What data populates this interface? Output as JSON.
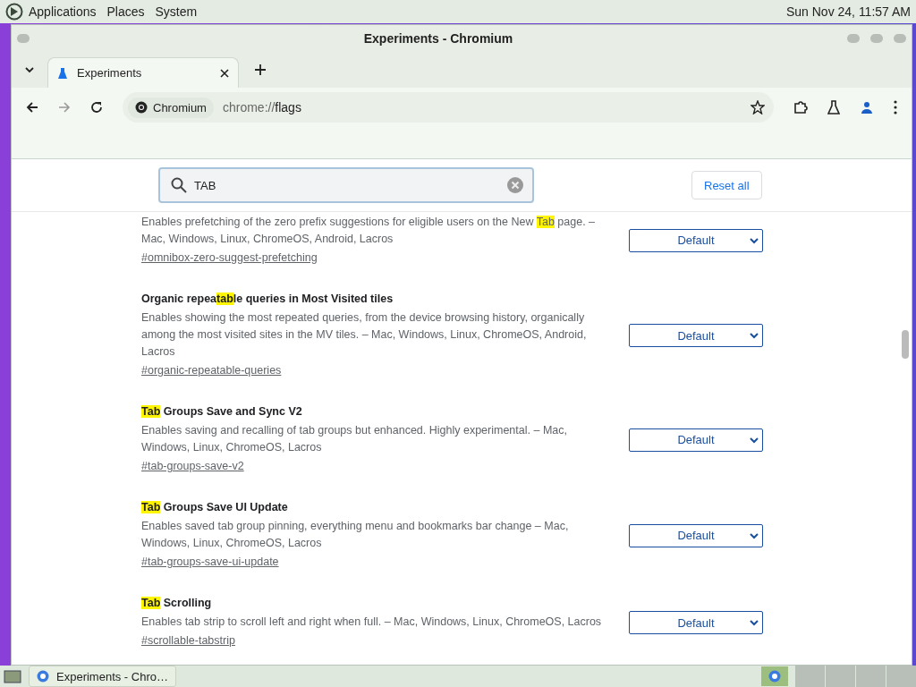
{
  "top_panel": {
    "menus": [
      "Applications",
      "Places",
      "System"
    ],
    "clock": "Sun Nov 24, 11:57 AM"
  },
  "window": {
    "title": "Experiments - Chromium"
  },
  "tabs": [
    {
      "label": "Experiments",
      "selected": true
    }
  ],
  "toolbar": {
    "site_chip": "Chromium",
    "url_scheme": "chrome://",
    "url_path": "flags"
  },
  "search": {
    "value": "TAB"
  },
  "reset_button": "Reset all",
  "flags": [
    {
      "description": [
        {
          "text": "Enables prefetching of the zero prefix suggestions for eligible users on the New "
        },
        {
          "text": "Tab",
          "highlight": true
        },
        {
          "text": " page. – Mac, Windows, Linux, ChromeOS, Android, Lacros"
        }
      ],
      "link": "#omnibox-zero-suggest-prefetching",
      "select": "Default"
    },
    {
      "title": [
        {
          "text": "Organic repea"
        },
        {
          "text": "tab",
          "highlight": true
        },
        {
          "text": "le queries in Most Visited tiles"
        }
      ],
      "description": [
        {
          "text": "Enables showing the most repeated queries, from the device browsing history, organically among the most visited sites in the MV tiles. – Mac, Windows, Linux, ChromeOS, Android, Lacros"
        }
      ],
      "link": "#organic-repeatable-queries",
      "select": "Default"
    },
    {
      "title": [
        {
          "text": "Tab",
          "highlight": true
        },
        {
          "text": " Groups Save and Sync V2"
        }
      ],
      "description": [
        {
          "text": "Enables saving and recalling of tab groups but enhanced. Highly experimental. – Mac, Windows, Linux, ChromeOS, Lacros"
        }
      ],
      "link": "#tab-groups-save-v2",
      "select": "Default"
    },
    {
      "title": [
        {
          "text": "Tab",
          "highlight": true
        },
        {
          "text": " Groups Save UI Update"
        }
      ],
      "description": [
        {
          "text": "Enables saved tab group pinning, everything menu and bookmarks bar change – Mac, Windows, Linux, ChromeOS, Lacros"
        }
      ],
      "link": "#tab-groups-save-ui-update",
      "select": "Default"
    },
    {
      "title": [
        {
          "text": "Tab",
          "highlight": true
        },
        {
          "text": " Scrolling"
        }
      ],
      "description": [
        {
          "text": "Enables tab strip to scroll left and right when full. – Mac, Windows, Linux, ChromeOS, Lacros"
        }
      ],
      "link": "#scrollable-tabstrip",
      "select": "Default"
    }
  ],
  "taskbar": {
    "windows": [
      {
        "label": "Experiments - Chro…",
        "selected": false
      }
    ]
  }
}
